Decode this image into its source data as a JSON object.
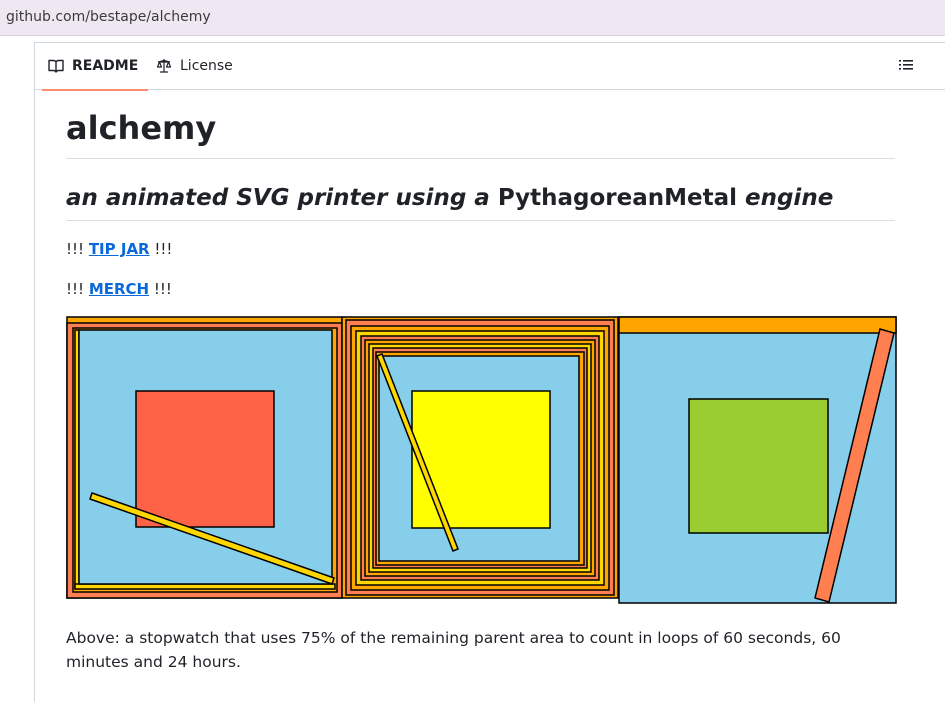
{
  "browser": {
    "url": "github.com/bestape/alchemy"
  },
  "tabs": {
    "readme": "README",
    "license": "License"
  },
  "readme": {
    "title": "alchemy",
    "subtitle_part1": "an animated SVG printer using a",
    "subtitle_part2": "PythagoreanMetal",
    "subtitle_part3": "engine",
    "tip_prefix": "!!!",
    "tip_link": "TIP JAR",
    "tip_suffix": "!!!",
    "merch_prefix": "!!!",
    "merch_link": "MERCH",
    "merch_suffix": "!!!",
    "caption": "Above: a stopwatch that uses 75% of the remaining parent area to count in loops of 60 seconds, 60 minutes and 24 hours."
  },
  "colors": {
    "orange": "#ffa500",
    "coral": "#ff7f50",
    "gold": "#ffd700",
    "sky": "#87ceeb",
    "tomato": "#ff6347",
    "yellow": "#ffff00",
    "yellowgreen": "#9acd32",
    "link": "#0969da",
    "tab_underline": "#fd8c73"
  },
  "icons": {
    "readme": "book-icon",
    "license": "law-scale-icon",
    "toc": "list-icon"
  }
}
